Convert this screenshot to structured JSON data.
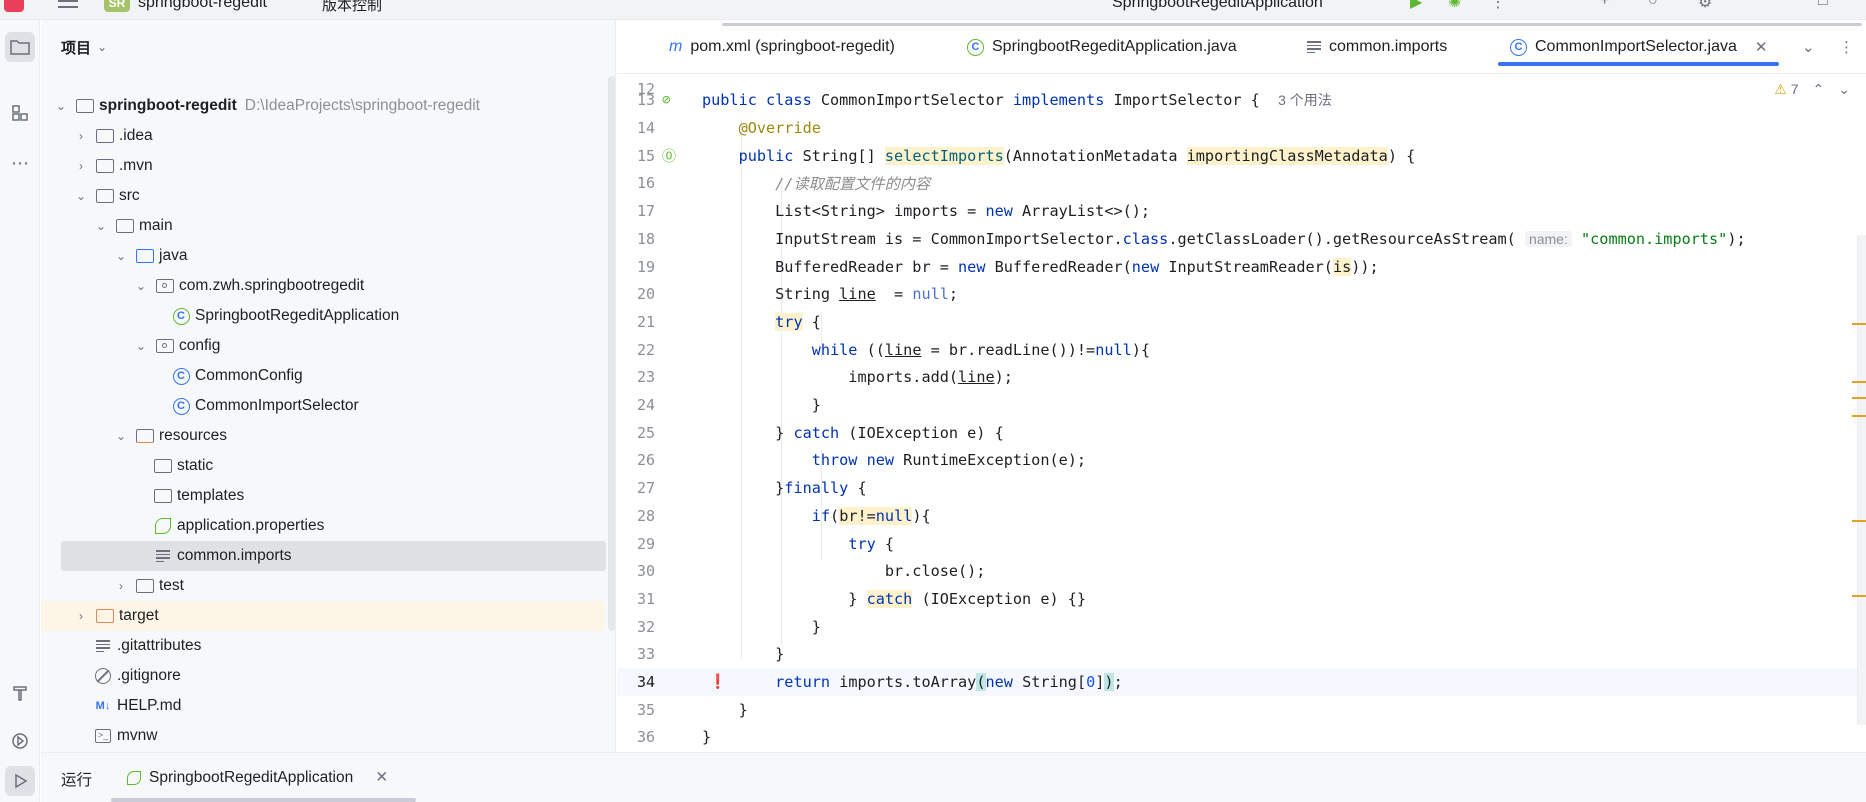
{
  "topbar": {
    "project_badge": "SR",
    "project_name": "springboot-regedit",
    "vcs_label": "版本控制",
    "run_config": "SpringbootRegeditApplication"
  },
  "project_panel": {
    "title": "项目",
    "tree": [
      {
        "label": "springboot-regedit",
        "path": "D:\\IdeaProjects\\springboot-regedit",
        "icon": "folder-icon"
      },
      {
        "label": ".idea",
        "icon": "folder-icon"
      },
      {
        "label": ".mvn",
        "icon": "folder-icon"
      },
      {
        "label": "src",
        "icon": "folder-icon"
      },
      {
        "label": "main",
        "icon": "folder-icon"
      },
      {
        "label": "java",
        "icon": "source-folder-icon"
      },
      {
        "label": "com.zwh.springbootregedit",
        "icon": "package-icon"
      },
      {
        "label": "SpringbootRegeditApplication",
        "icon": "spring-class-icon"
      },
      {
        "label": "config",
        "icon": "package-icon"
      },
      {
        "label": "CommonConfig",
        "icon": "class-icon"
      },
      {
        "label": "CommonImportSelector",
        "icon": "class-icon"
      },
      {
        "label": "resources",
        "icon": "resources-folder-icon"
      },
      {
        "label": "static",
        "icon": "folder-icon"
      },
      {
        "label": "templates",
        "icon": "folder-icon"
      },
      {
        "label": "application.properties",
        "icon": "spring-properties-icon"
      },
      {
        "label": "common.imports",
        "icon": "text-file-icon"
      },
      {
        "label": "test",
        "icon": "folder-icon"
      },
      {
        "label": "target",
        "icon": "excluded-folder-icon"
      },
      {
        "label": ".gitattributes",
        "icon": "text-file-icon"
      },
      {
        "label": ".gitignore",
        "icon": "ignore-file-icon"
      },
      {
        "label": "HELP.md",
        "icon": "markdown-icon"
      },
      {
        "label": "mvnw",
        "icon": "shell-script-icon"
      }
    ]
  },
  "tabs": [
    {
      "label": "pom.xml (springboot-regedit)",
      "icon": "maven-icon"
    },
    {
      "label": "SpringbootRegeditApplication.java",
      "icon": "spring-class-icon"
    },
    {
      "label": "common.imports",
      "icon": "text-file-icon"
    },
    {
      "label": "CommonImportSelector.java",
      "icon": "class-icon",
      "active": true
    }
  ],
  "editor": {
    "warnings_count": "7",
    "line_numbers": [
      "12",
      "13",
      "14",
      "15",
      "16",
      "17",
      "18",
      "19",
      "20",
      "21",
      "22",
      "23",
      "24",
      "25",
      "26",
      "27",
      "28",
      "29",
      "30",
      "31",
      "32",
      "33",
      "34",
      "35",
      "36"
    ],
    "usages_hint": "3 个用法",
    "param_hint": "name:",
    "comment_text": "//读取配置文件的内容"
  },
  "run_panel": {
    "title": "运行",
    "tab_label": "SpringbootRegeditApplication"
  },
  "colors": {
    "accent": "#3574f0",
    "keyword": "#0033b3",
    "string": "#067d17",
    "annotation": "#9e880d",
    "warning": "#e5a21e",
    "error": "#db3b4b"
  }
}
